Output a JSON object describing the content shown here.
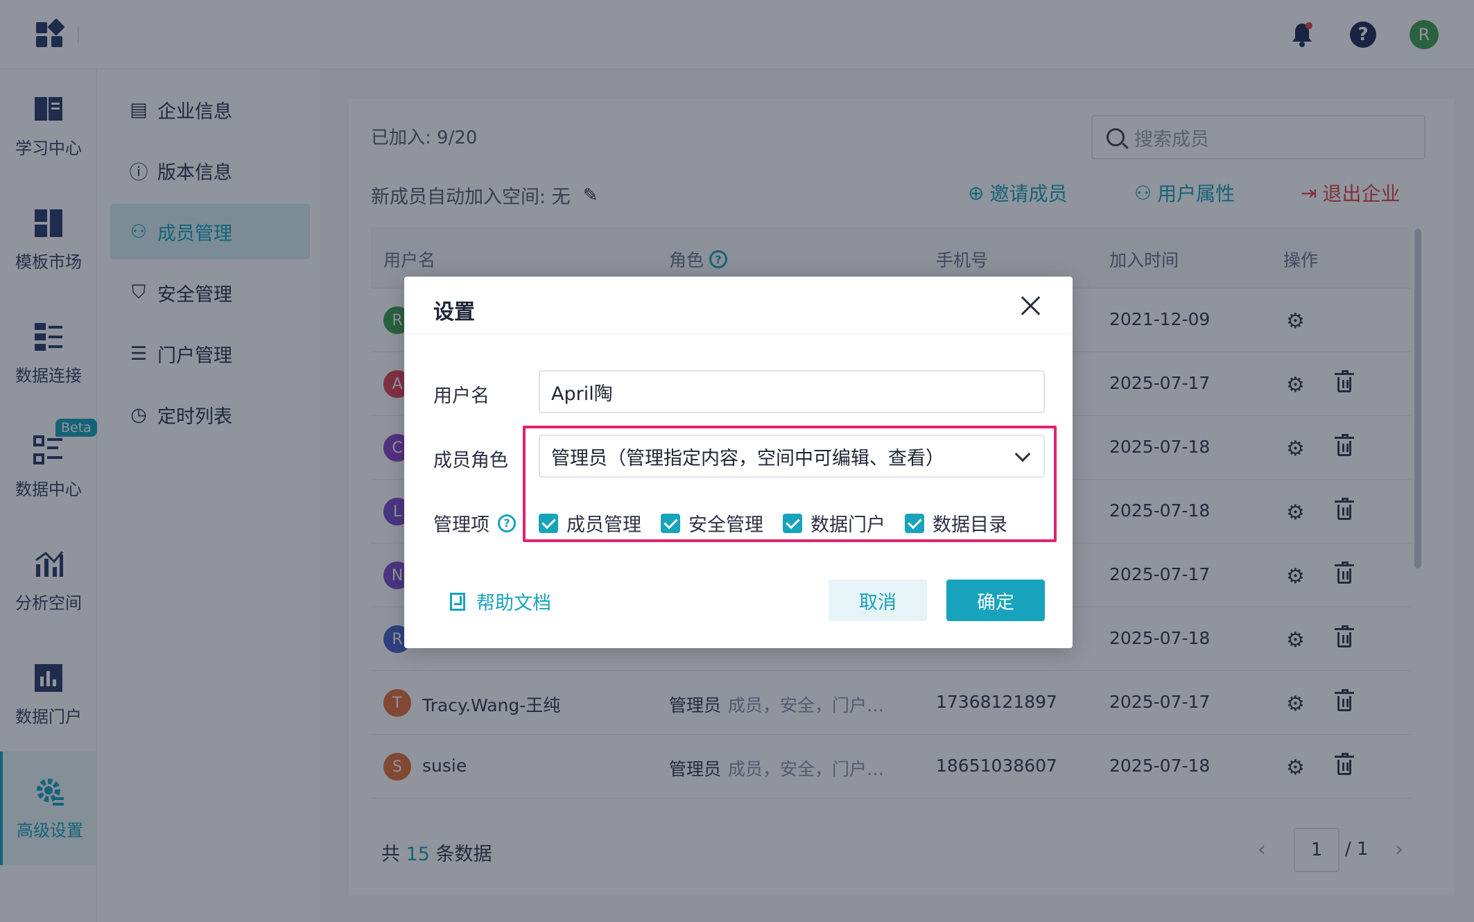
{
  "topbar": {
    "avatar_letter": "R",
    "icons": [
      "apps-logo-icon",
      "bell-icon",
      "help-icon"
    ]
  },
  "rail": {
    "items": [
      {
        "label": "学习中心",
        "icon": "book-icon"
      },
      {
        "label": "模板市场",
        "icon": "template-icon"
      },
      {
        "label": "数据连接",
        "icon": "connect-icon"
      },
      {
        "label": "数据中心",
        "icon": "data-center-icon",
        "badge": "Beta"
      },
      {
        "label": "分析空间",
        "icon": "analysis-icon"
      },
      {
        "label": "数据门户",
        "icon": "portal-icon"
      },
      {
        "label": "高级设置",
        "icon": "advanced-settings-icon",
        "active": true
      }
    ]
  },
  "submenu": {
    "items": [
      {
        "label": "企业信息",
        "icon": "building-icon"
      },
      {
        "label": "版本信息",
        "icon": "info-icon"
      },
      {
        "label": "成员管理",
        "icon": "member-icon",
        "active": true
      },
      {
        "label": "安全管理",
        "icon": "shield-icon"
      },
      {
        "label": "门户管理",
        "icon": "list-icon"
      },
      {
        "label": "定时列表",
        "icon": "schedule-icon"
      }
    ]
  },
  "main": {
    "joined": "已加入: 9/20",
    "search_placeholder": "搜索成员",
    "autojoin": "新成员自动加入空间: 无",
    "actions": {
      "invite": "邀请成员",
      "attributes": "用户属性",
      "exit": "退出企业"
    },
    "columns": [
      "用户名",
      "角色",
      "手机号",
      "加入时间",
      "操作"
    ],
    "rows": [
      {
        "initial": "R",
        "color": "#3f9f4f",
        "name": "",
        "role": "",
        "tags": "",
        "phone": "",
        "date": "2021-12-09",
        "deletable": false
      },
      {
        "initial": "A",
        "color": "#e0445a",
        "name": "",
        "role": "",
        "tags": "",
        "phone": "",
        "date": "2025-07-17",
        "deletable": true
      },
      {
        "initial": "C",
        "color": "#8e44c8",
        "name": "",
        "role": "",
        "tags": "",
        "phone": "",
        "date": "2025-07-18",
        "deletable": true
      },
      {
        "initial": "L",
        "color": "#7e4fcf",
        "name": "",
        "role": "",
        "tags": "",
        "phone": "",
        "date": "2025-07-18",
        "deletable": true
      },
      {
        "initial": "N",
        "color": "#7e4fcf",
        "name": "",
        "role": "",
        "tags": "",
        "phone": "",
        "date": "2025-07-17",
        "deletable": true
      },
      {
        "initial": "R",
        "color": "#4a63c9",
        "name": "",
        "role": "",
        "tags": "",
        "phone": "",
        "date": "2025-07-18",
        "deletable": true
      },
      {
        "initial": "T",
        "color": "#e2703a",
        "name": "Tracy.Wang-王纯",
        "role": "管理员",
        "tags": "成员，安全，门户…",
        "phone": "17368121897",
        "date": "2025-07-17",
        "deletable": true
      },
      {
        "initial": "S",
        "color": "#e2703a",
        "name": "susie",
        "role": "管理员",
        "tags": "成员，安全，门户…",
        "phone": "18651038607",
        "date": "2025-07-18",
        "deletable": true
      }
    ],
    "total_prefix": "共",
    "total_count": "15",
    "total_suffix": "条数据",
    "page": "1",
    "page_total": "/ 1"
  },
  "modal": {
    "title": "设置",
    "username_label": "用户名",
    "username_value": "April陶",
    "role_label": "成员角色",
    "role_value": "管理员（管理指定内容，空间中可编辑、查看）",
    "manage_label": "管理项",
    "checkboxes": [
      "成员管理",
      "安全管理",
      "数据门户",
      "数据目录"
    ],
    "help_doc": "帮助文档",
    "cancel": "取消",
    "confirm": "确定",
    "highlight_color": "#e0236f"
  }
}
